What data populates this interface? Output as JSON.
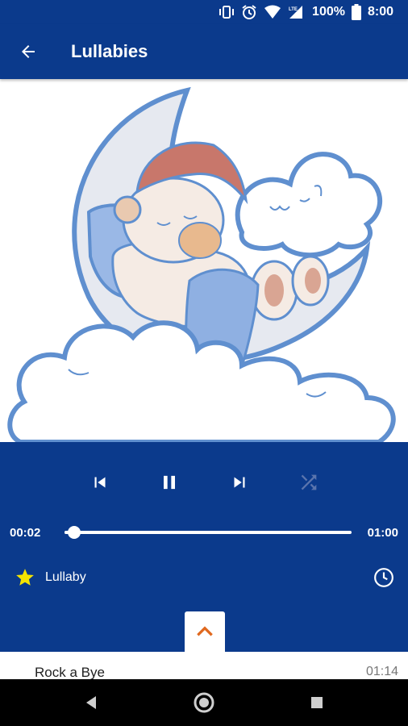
{
  "status_bar": {
    "battery_text": "100%",
    "time": "8:00",
    "network": "LTE",
    "icons": [
      "vibrate-icon",
      "alarm-icon",
      "wifi-icon",
      "cell-signal-icon",
      "battery-icon"
    ]
  },
  "app_bar": {
    "title": "Lullabies",
    "back_icon": "arrow-back-icon"
  },
  "artwork": {
    "description_icon": "sleeping-bear-on-moon-illustration"
  },
  "player": {
    "controls": [
      {
        "name": "previous-button",
        "icon": "skip-previous-icon",
        "enabled": true
      },
      {
        "name": "pause-button",
        "icon": "pause-icon",
        "enabled": true
      },
      {
        "name": "next-button",
        "icon": "skip-next-icon",
        "enabled": true
      },
      {
        "name": "shuffle-button",
        "icon": "shuffle-icon",
        "enabled": false
      }
    ],
    "current_time": "00:02",
    "total_time": "01:00",
    "progress": 0.033,
    "category": "Lullaby",
    "favorite_icon": "star-icon",
    "timer_icon": "clock-icon",
    "expand_icon": "chevron-up-icon"
  },
  "playlist": {
    "items": [
      {
        "title": "Rock a Bye",
        "duration": "01:14"
      }
    ]
  },
  "nav_bar": {
    "icons": [
      "back-triangle-icon",
      "home-circle-icon",
      "recents-square-icon"
    ]
  },
  "colors": {
    "primary": "#0b3a8c",
    "accent_orange": "#e0691f",
    "star_yellow": "#f5e400",
    "white": "#ffffff"
  }
}
